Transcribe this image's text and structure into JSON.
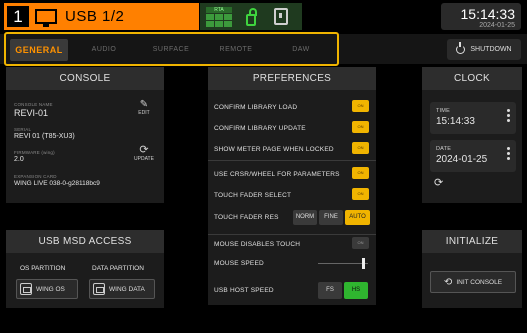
{
  "header": {
    "channel_number": "1",
    "channel_name": "USB 1/2",
    "status_grid_label": "RTA",
    "clock_time": "15:14:33",
    "clock_date": "2024-01-25"
  },
  "tabs": [
    {
      "label": "GENERAL",
      "active": true
    },
    {
      "label": "AUDIO",
      "active": false
    },
    {
      "label": "SURFACE",
      "active": false
    },
    {
      "label": "REMOTE",
      "active": false
    },
    {
      "label": "DAW",
      "active": false
    }
  ],
  "shutdown_label": "SHUTDOWN",
  "console": {
    "title": "CONSOLE",
    "name_label": "CONSOLE NAME",
    "name_value": "REVI-01",
    "edit_label": "EDIT",
    "serial_label": "SERIAL",
    "serial_value": "REVI 01 (T85-XU3)",
    "firmware_label": "FIRMWARE (wing)",
    "firmware_value": "2.0",
    "update_label": "UPDATE",
    "expansion_label": "EXPANSION CARD",
    "expansion_value": "WING LIVE 038-0-g28118bc9"
  },
  "usb": {
    "title": "USB MSD ACCESS",
    "os_label": "OS PARTITION",
    "data_label": "DATA PARTITION",
    "os_button": "WING OS",
    "data_button": "WING DATA"
  },
  "preferences": {
    "title": "PREFERENCES",
    "rows": [
      {
        "label": "CONFIRM LIBRARY LOAD",
        "state": "ON"
      },
      {
        "label": "CONFIRM LIBRARY UPDATE",
        "state": "ON"
      },
      {
        "label": "SHOW METER PAGE WHEN LOCKED",
        "state": "ON"
      },
      {
        "label": "USE CRSR/WHEEL FOR PARAMETERS",
        "state": "ON"
      },
      {
        "label": "TOUCH FADER SELECT",
        "state": "ON"
      },
      {
        "label": "MOUSE DISABLES TOUCH",
        "state": "ON"
      }
    ],
    "fader_res_label": "TOUCH FADER RES",
    "fader_res_options": [
      "NORM",
      "FINE",
      "AUTO"
    ],
    "fader_res_selected": "AUTO",
    "mouse_speed_label": "MOUSE SPEED",
    "mouse_speed_level": 0.9,
    "usb_speed_label": "USB HOST SPEED",
    "usb_speed_options": [
      "FS",
      "HS"
    ],
    "usb_speed_selected": "HS"
  },
  "clock": {
    "title": "CLOCK",
    "time_label": "TIME",
    "time_value": "15:14:33",
    "date_label": "DATE",
    "date_value": "2024-01-25"
  },
  "initialize": {
    "title": "INITIALIZE",
    "button": "INIT CONSOLE"
  },
  "colors": {
    "accent": "#ff8000",
    "toggle_on": "#f0b400",
    "hs_active": "#2fb52f",
    "auto_active": "#f0b400"
  }
}
